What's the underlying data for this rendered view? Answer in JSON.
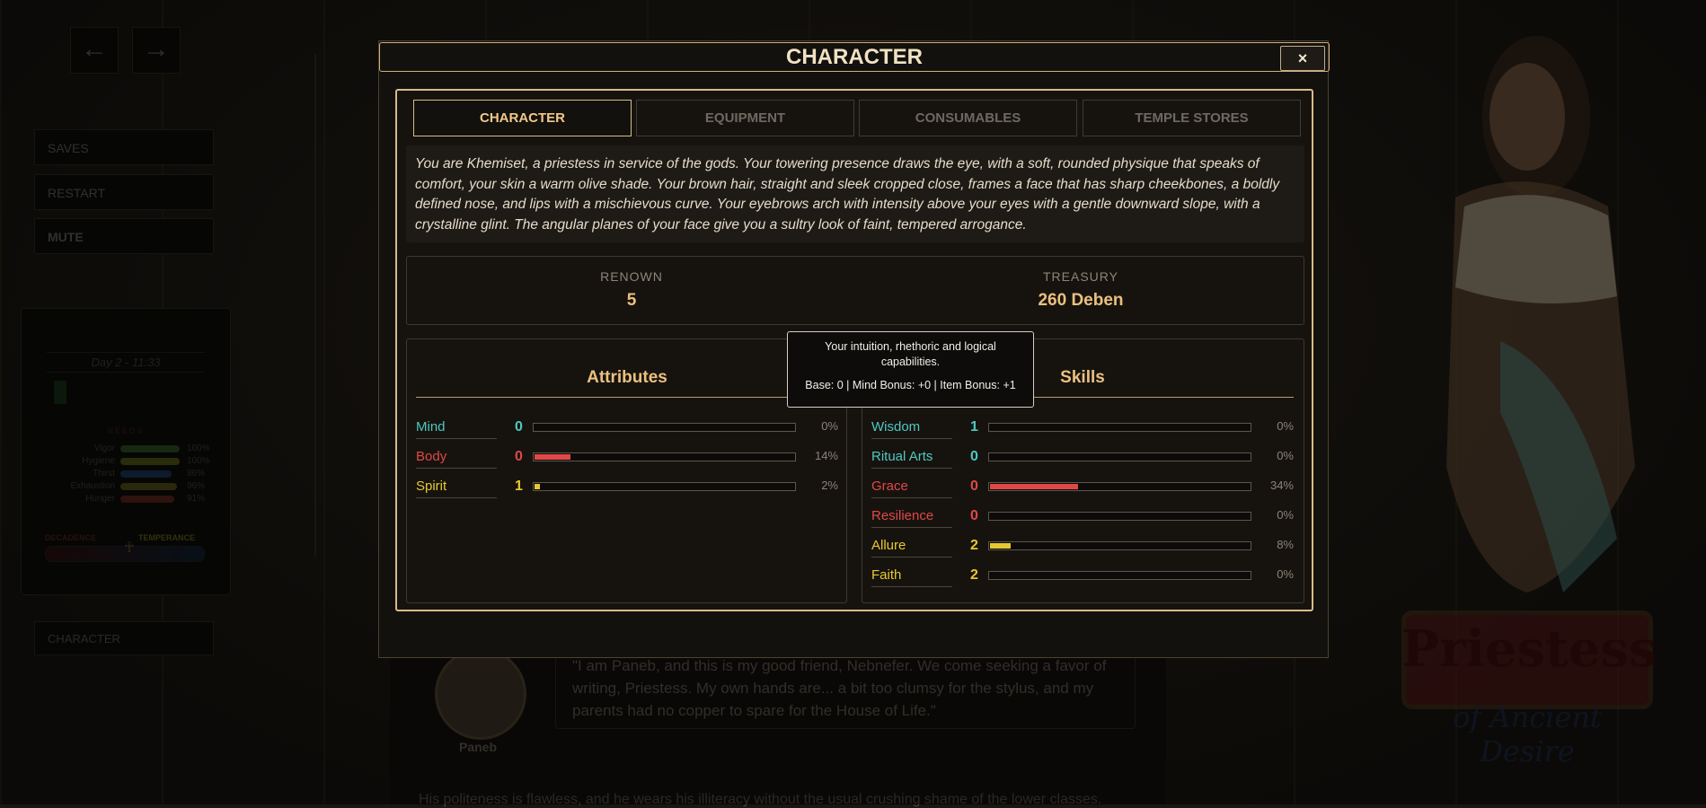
{
  "nav": {
    "back_icon": "arrow-left-icon",
    "forward_icon": "arrow-right-icon"
  },
  "menu": {
    "saves": "SAVES",
    "restart": "RESTART",
    "mute": "MUTE",
    "character": "CHARACTER"
  },
  "status": {
    "datetime": "Day 2 - 11:33",
    "needs_label": "NEEDS",
    "needs": [
      {
        "label": "Vigor",
        "value": 100,
        "pct": "100%",
        "color": "#4a8a3a"
      },
      {
        "label": "Hygiene",
        "value": 100,
        "pct": "100%",
        "color": "#8a9a2a"
      },
      {
        "label": "Thirst",
        "value": 86,
        "pct": "86%",
        "color": "#2a5a9a"
      },
      {
        "label": "Exhaustion",
        "value": 96,
        "pct": "96%",
        "color": "#8a8a2a"
      },
      {
        "label": "Hunger",
        "value": 91,
        "pct": "91%",
        "color": "#9a3a2a"
      }
    ],
    "decadence_label": "DECADENCE",
    "temperance_label": "TEMPERANCE"
  },
  "dialogue": {
    "speaker": "Paneb",
    "quote": "\"I am Paneb, and this is my good friend, Nebnefer. We come seeking a favor of writing, Priestess. My own hands are... a bit too clumsy for the stylus, and my parents had no copper to spare for the House of Life.\"",
    "narration": "His politeness is flawless, and he wears his illiteracy without the usual crushing shame of the lower classes."
  },
  "logo": {
    "title": "Priestess",
    "subtitle": "of Ancient Desire"
  },
  "modal": {
    "title": "CHARACTER",
    "close_label": "×",
    "tabs": [
      {
        "label": "CHARACTER",
        "active": true
      },
      {
        "label": "EQUIPMENT",
        "active": false
      },
      {
        "label": "CONSUMABLES",
        "active": false
      },
      {
        "label": "TEMPLE STORES",
        "active": false
      }
    ],
    "description": "You are Khemiset, a priestess in service of the gods. Your towering presence draws the eye, with a soft, rounded physique that speaks of comfort, your skin a warm olive shade. Your brown hair, straight and sleek cropped close, frames a face that has sharp cheekbones, a boldly defined nose, and lips with a mischievous curve. Your eyebrows arch with intensity above your eyes with a gentle downward slope, with a crystalline glint. The angular planes of your face give you a sultry look of faint, tempered arrogance.",
    "renown_label": "RENOWN",
    "renown_value": "5",
    "treasury_label": "TREASURY",
    "treasury_value": "260 Deben",
    "attributes_title": "Attributes",
    "skills_title": "Skills",
    "attributes": [
      {
        "name": "Mind",
        "value": "0",
        "progress": 0,
        "pct": "0%",
        "color": "#4fc8c0"
      },
      {
        "name": "Body",
        "value": "0",
        "progress": 14,
        "pct": "14%",
        "color": "#e04848"
      },
      {
        "name": "Spirit",
        "value": "1",
        "progress": 2,
        "pct": "2%",
        "color": "#e8c830"
      }
    ],
    "skills": [
      {
        "name": "Wisdom",
        "value": "1",
        "progress": 0,
        "pct": "0%",
        "color": "#4fc8c0"
      },
      {
        "name": "Ritual Arts",
        "value": "0",
        "progress": 0,
        "pct": "0%",
        "color": "#4fc8c0"
      },
      {
        "name": "Grace",
        "value": "0",
        "progress": 34,
        "pct": "34%",
        "color": "#e04848"
      },
      {
        "name": "Resilience",
        "value": "0",
        "progress": 0,
        "pct": "0%",
        "color": "#e04848"
      },
      {
        "name": "Allure",
        "value": "2",
        "progress": 8,
        "pct": "8%",
        "color": "#e8c830"
      },
      {
        "name": "Faith",
        "value": "2",
        "progress": 0,
        "pct": "0%",
        "color": "#e8c830"
      }
    ],
    "tooltip": {
      "line1": "Your intuition, rhethoric and logical capabilities.",
      "line2": "Base: 0 | Mind Bonus: +0 | Item Bonus: +1"
    }
  }
}
